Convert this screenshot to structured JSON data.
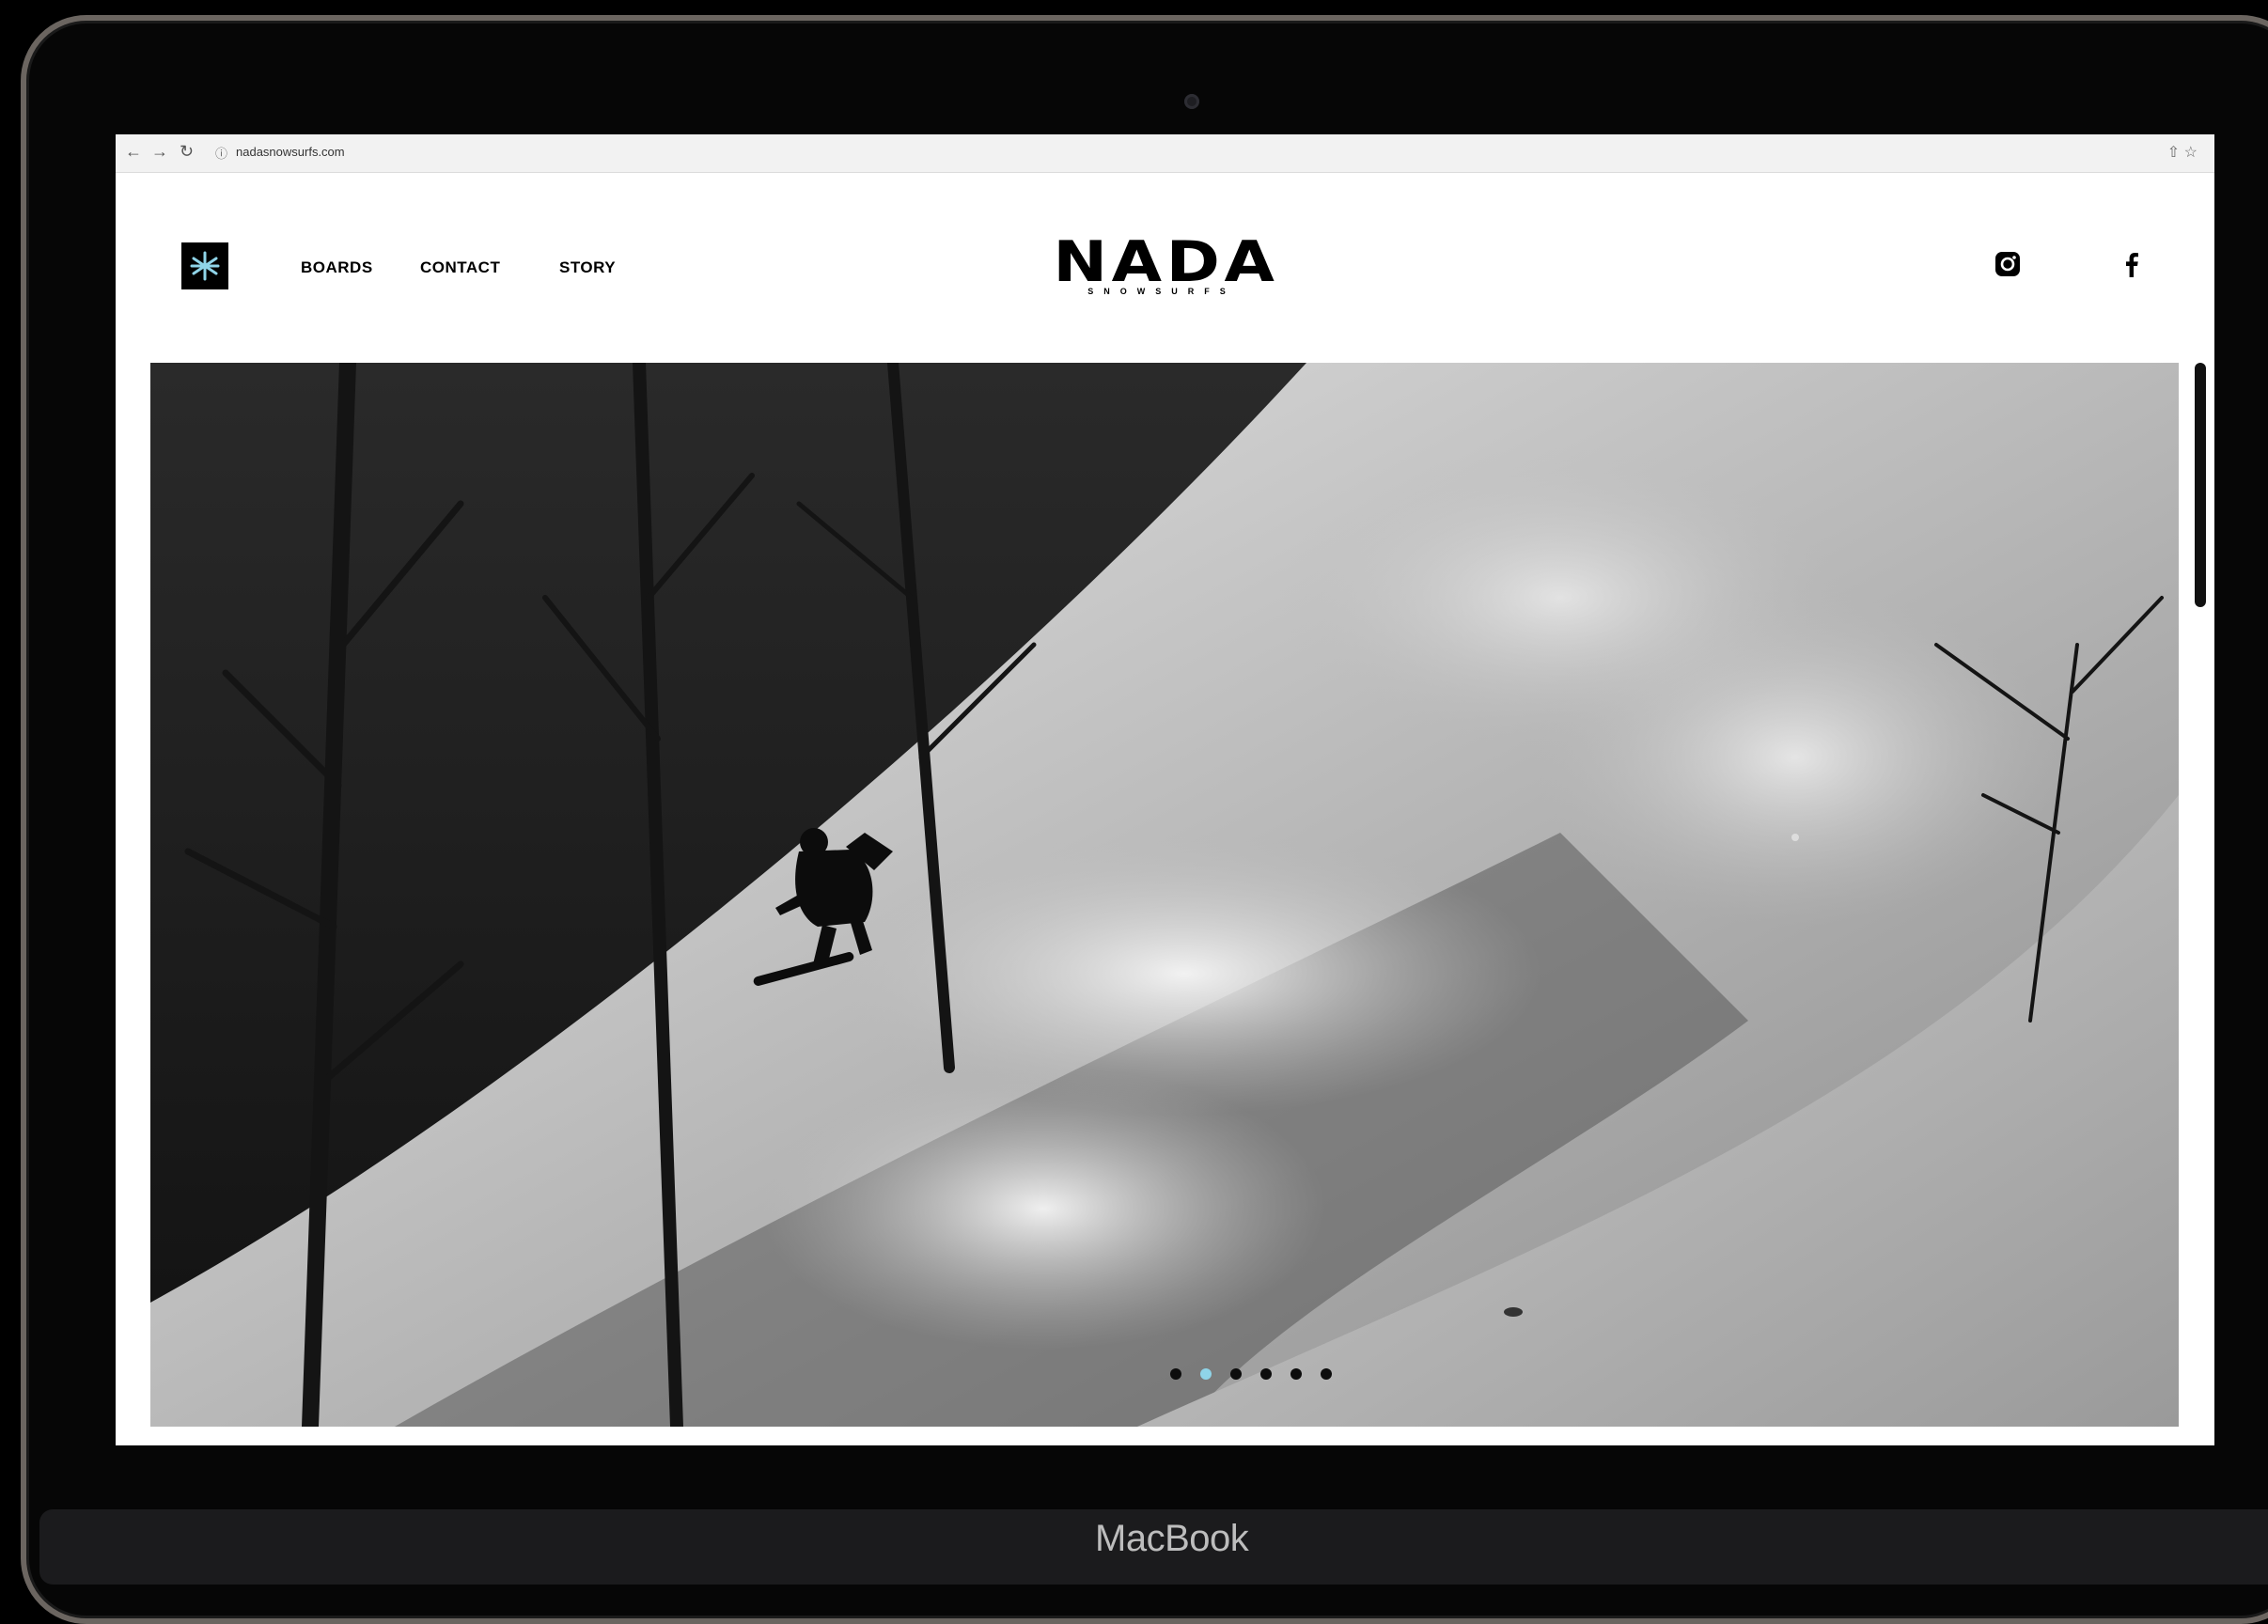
{
  "browser": {
    "url": "nadasnowsurfs.com",
    "back_glyph": "←",
    "forward_glyph": "→",
    "reload_glyph": "↻",
    "site_info_glyph": "ⓘ",
    "toolbar_right_glyph": "⇧ ☆"
  },
  "header": {
    "nav": [
      {
        "label": "BOARDS"
      },
      {
        "label": "CONTACT"
      },
      {
        "label": "STORY"
      }
    ],
    "brand": {
      "name": "NADA",
      "tagline": "SNOWSURFS"
    },
    "logo_icon": "snowflake-logo-icon",
    "social": [
      "instagram-icon",
      "facebook-icon"
    ]
  },
  "hero": {
    "slide_count": 6,
    "active_slide": 2
  },
  "device": {
    "label": "MacBook"
  },
  "colors": {
    "accent": "#8fd4e8",
    "text": "#000000",
    "background": "#ffffff"
  }
}
